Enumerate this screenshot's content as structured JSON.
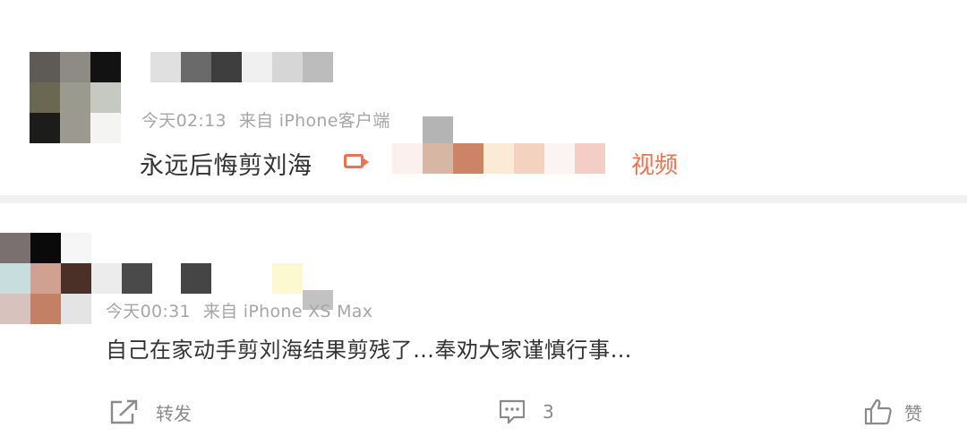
{
  "posts": [
    {
      "meta": {
        "time": "今天02:13",
        "source": "来自 iPhone客户端"
      },
      "content": "永远后悔剪刘海",
      "video_link": "视频"
    },
    {
      "meta": {
        "time": "今天00:31",
        "source": "来自 iPhone XS Max"
      },
      "content": "自己在家动手剪刘海结果剪残了…奉劝大家谨慎行事…"
    }
  ],
  "actions": {
    "repost_label": "转发",
    "comment_count": "3",
    "like_label": "赞"
  },
  "icons": [
    "share-icon",
    "comment-icon",
    "like-icon",
    "video-icon"
  ],
  "colors": {
    "link": "#eb7350",
    "meta": "#a6a6a6",
    "text": "#333333"
  }
}
